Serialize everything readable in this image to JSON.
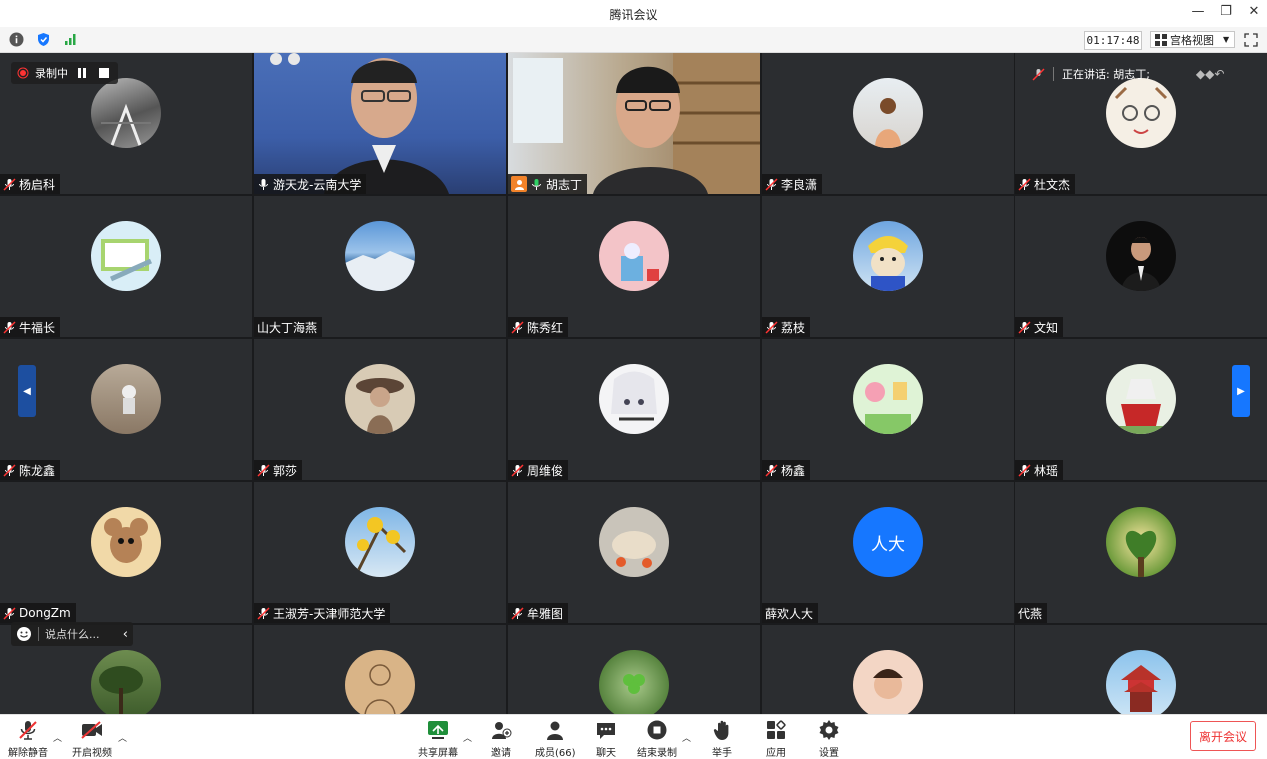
{
  "window": {
    "title": "腾讯会议"
  },
  "toolbar": {
    "timer": "01:17:48",
    "view_label": "宫格视图"
  },
  "overlay": {
    "recording_label": "录制中",
    "speaking_label": "正在讲话: 胡志丁;",
    "chat_placeholder": "说点什么..."
  },
  "tiles": [
    {
      "name": "杨启科"
    },
    {
      "name": "游天龙-云南大学"
    },
    {
      "name": "胡志丁"
    },
    {
      "name": "李良潇"
    },
    {
      "name": "杜文杰"
    },
    {
      "name": "牛福长"
    },
    {
      "name": "山大丁海燕"
    },
    {
      "name": "陈秀红"
    },
    {
      "name": "荔枝"
    },
    {
      "name": "文知"
    },
    {
      "name": "陈龙鑫"
    },
    {
      "name": "郭莎"
    },
    {
      "name": "周维俊"
    },
    {
      "name": "杨鑫"
    },
    {
      "name": "林瑶"
    },
    {
      "name": "DongZm"
    },
    {
      "name": "王淑芳-天津师范大学"
    },
    {
      "name": "牟雅图"
    },
    {
      "name": "薛欢人大",
      "avatar_text": "人大"
    },
    {
      "name": "代燕"
    }
  ],
  "bottom": {
    "unmute": "解除静音",
    "start_video": "开启视频",
    "share_screen": "共享屏幕",
    "invite": "邀请",
    "members": "成员(66)",
    "chat": "聊天",
    "end_record": "结束录制",
    "raise_hand": "举手",
    "apps": "应用",
    "settings": "设置",
    "leave": "离开会议"
  },
  "colors": {
    "active_border": "#27b04e",
    "accent_blue": "#1677ff",
    "leave_red": "#e33333"
  }
}
